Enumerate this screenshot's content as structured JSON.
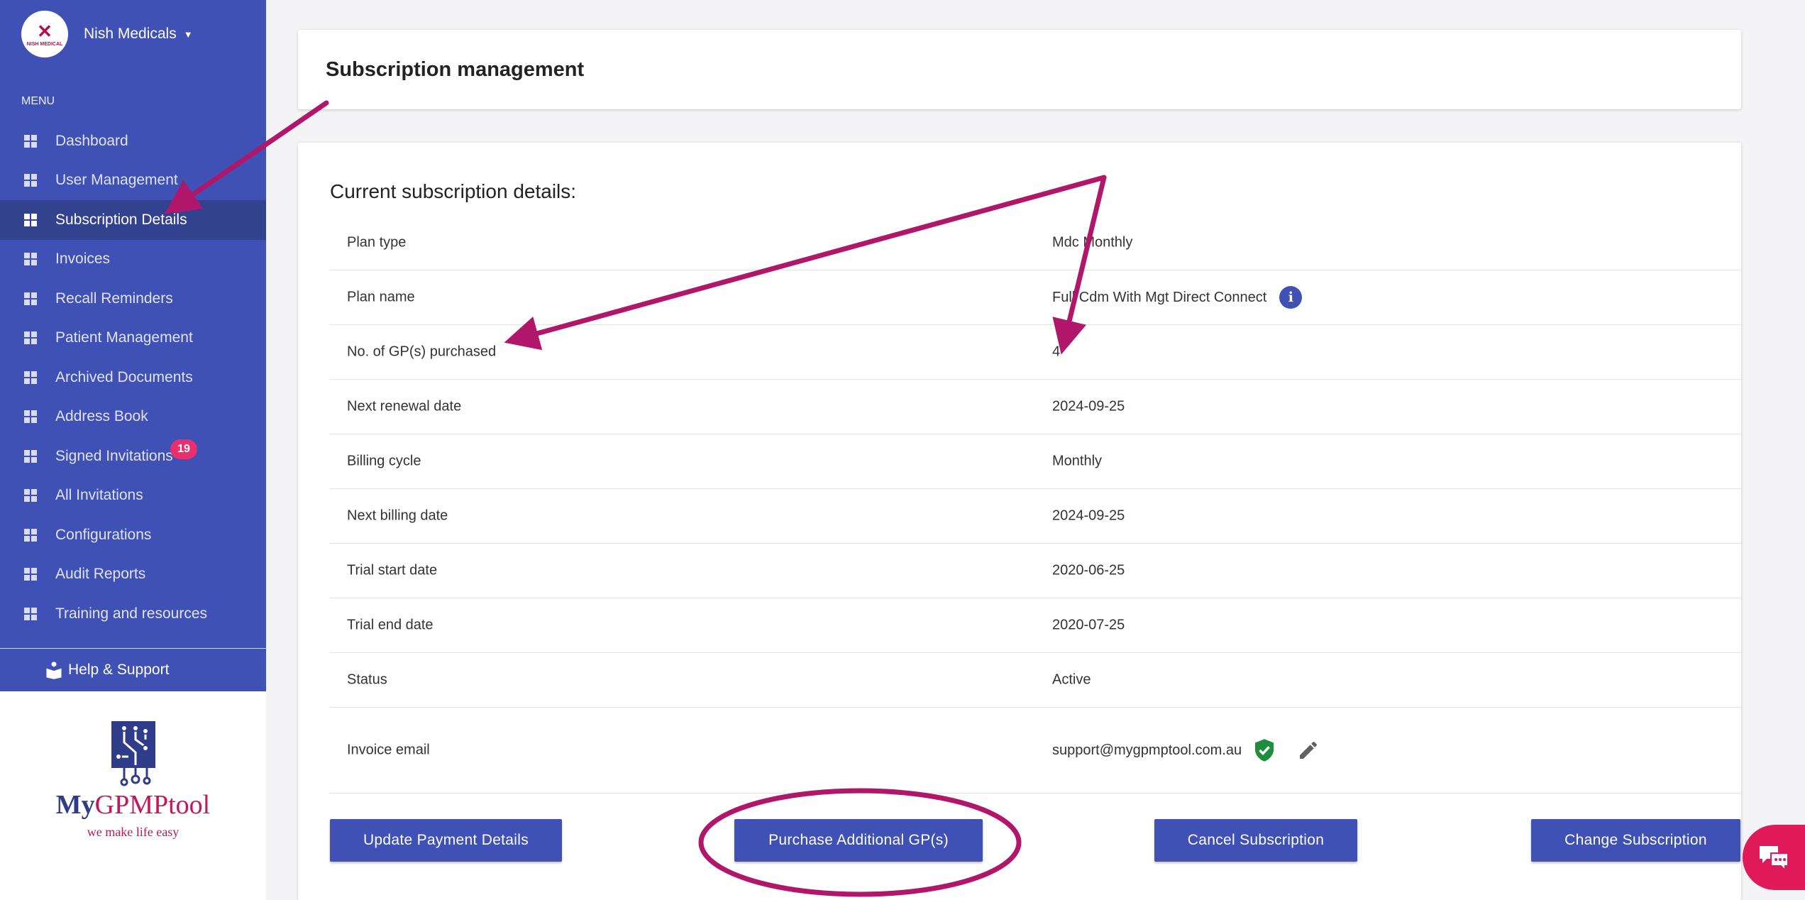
{
  "brand": {
    "name": "Nish Medicals",
    "logo_text": "NISH MEDICAL"
  },
  "sidebar": {
    "menu_title": "MENU",
    "items": [
      {
        "label": "Dashboard"
      },
      {
        "label": "User Management"
      },
      {
        "label": "Subscription Details",
        "active": true
      },
      {
        "label": "Invoices"
      },
      {
        "label": "Recall Reminders"
      },
      {
        "label": "Patient Management"
      },
      {
        "label": "Archived Documents"
      },
      {
        "label": "Address Book"
      },
      {
        "label": "Signed Invitations",
        "badge": "19"
      },
      {
        "label": "All Invitations"
      },
      {
        "label": "Configurations"
      },
      {
        "label": "Audit Reports"
      },
      {
        "label": "Training and resources"
      }
    ],
    "help_label": "Help & Support"
  },
  "footer_logo": {
    "name_prefix": "My",
    "name_rest": "GPMPtool",
    "tagline": "we make life easy"
  },
  "header": {
    "title": "Subscription management"
  },
  "details": {
    "section_title": "Current subscription details:",
    "rows": [
      {
        "label": "Plan type",
        "value": "Mdc Monthly"
      },
      {
        "label": "Plan name",
        "value": "Full Cdm With Mgt Direct Connect"
      },
      {
        "label": "No. of GP(s) purchased",
        "value": "4"
      },
      {
        "label": "Next renewal date",
        "value": "2024-09-25"
      },
      {
        "label": "Billing cycle",
        "value": "Monthly"
      },
      {
        "label": "Next billing date",
        "value": "2024-09-25"
      },
      {
        "label": "Trial start date",
        "value": "2020-06-25"
      },
      {
        "label": "Trial end date",
        "value": "2020-07-25"
      },
      {
        "label": "Status",
        "value": "Active"
      },
      {
        "label": "Invoice email",
        "value": "support@mygpmptool.com.au"
      }
    ]
  },
  "buttons": {
    "update_payment": "Update Payment Details",
    "purchase_gp": "Purchase Additional GP(s)",
    "cancel_subscription": "Cancel Subscription",
    "change_subscription": "Change Subscription"
  },
  "icons": {
    "info": "info-icon",
    "verified": "shield-check-icon",
    "edit": "pencil-icon",
    "chat": "chat-icon",
    "help": "book-icon"
  },
  "colors": {
    "sidebar": "#3f51b5",
    "sidebar_active": "#32428f",
    "button": "#3f51b5",
    "annotation": "#b0176a",
    "badge": "#e8306e",
    "verified": "#1e8e3e",
    "chat": "#e0195a"
  }
}
